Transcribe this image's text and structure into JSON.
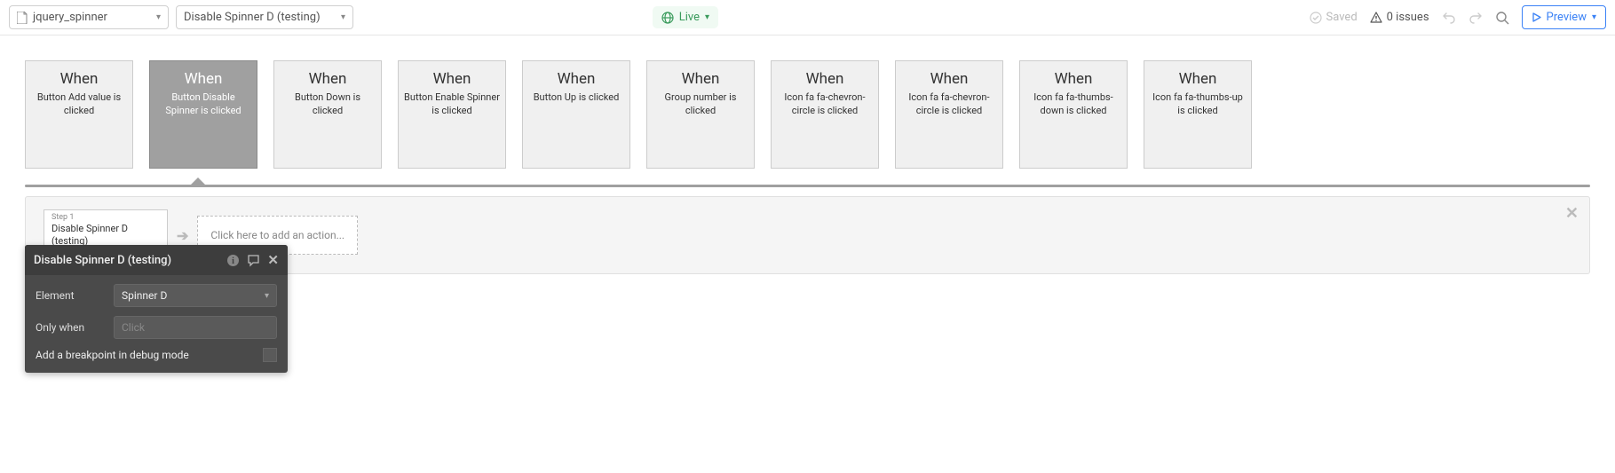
{
  "topbar": {
    "page_dropdown": "jquery_spinner",
    "workflow_dropdown": "Disable Spinner D (testing)",
    "live_label": "Live",
    "saved_label": "Saved",
    "issues_label": "0 issues",
    "preview_label": "Preview"
  },
  "cards": [
    {
      "when": "When",
      "desc": "Button Add value is clicked"
    },
    {
      "when": "When",
      "desc": "Button Disable Spinner is clicked"
    },
    {
      "when": "When",
      "desc": "Button Down is clicked"
    },
    {
      "when": "When",
      "desc": "Button Enable Spinner is clicked"
    },
    {
      "when": "When",
      "desc": "Button Up is clicked"
    },
    {
      "when": "When",
      "desc": "Group number is clicked"
    },
    {
      "when": "When",
      "desc": "Icon fa fa-chevron-circle is clicked"
    },
    {
      "when": "When",
      "desc": "Icon fa fa-chevron-circle is clicked"
    },
    {
      "when": "When",
      "desc": "Icon fa fa-thumbs-down is clicked"
    },
    {
      "when": "When",
      "desc": "Icon fa fa-thumbs-up is clicked"
    }
  ],
  "steps": {
    "step_label": "Step 1",
    "step_name": "Disable Spinner D (testing)",
    "delete_label": "delete",
    "add_action_label": "Click here to add an action..."
  },
  "editor": {
    "title": "Disable Spinner D (testing)",
    "element_label": "Element",
    "element_value": "Spinner D",
    "only_when_label": "Only when",
    "only_when_placeholder": "Click",
    "breakpoint_label": "Add a breakpoint in debug mode"
  }
}
